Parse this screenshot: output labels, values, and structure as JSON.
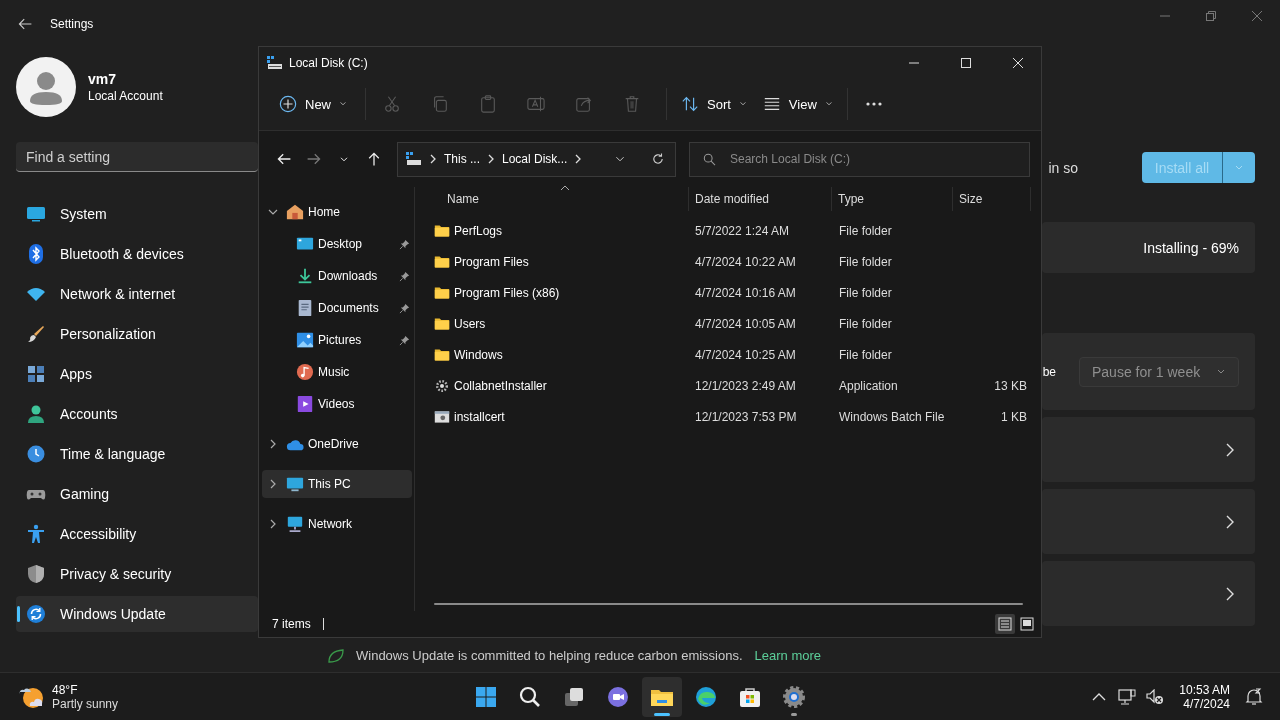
{
  "settings": {
    "title": "Settings",
    "user": {
      "name": "vm7",
      "account": "Local Account"
    },
    "search": {
      "placeholder": "Find a setting"
    },
    "nav": [
      {
        "label": "System",
        "selected": false
      },
      {
        "label": "Bluetooth & devices",
        "selected": false
      },
      {
        "label": "Network & internet",
        "selected": false
      },
      {
        "label": "Personalization",
        "selected": false
      },
      {
        "label": "Apps",
        "selected": false
      },
      {
        "label": "Accounts",
        "selected": false
      },
      {
        "label": "Time & language",
        "selected": false
      },
      {
        "label": "Gaming",
        "selected": false
      },
      {
        "label": "Accessibility",
        "selected": false
      },
      {
        "label": "Privacy & security",
        "selected": false
      },
      {
        "label": "Windows Update",
        "selected": true
      }
    ],
    "update": {
      "status_tail": "in so",
      "install_button": {
        "label": "Install all",
        "disabled": true
      },
      "progress": "Installing - 69%",
      "pause_tail": "be",
      "pause_dropdown": "Pause for 1 week",
      "footer": "Windows Update is committed to helping reduce carbon emissions.",
      "footer_link": "Learn more"
    }
  },
  "explorer": {
    "title": "Local Disk (C:)",
    "new_button": "New",
    "actions": [
      {
        "disabled": true
      },
      {
        "disabled": true
      },
      {
        "disabled": true
      },
      {
        "disabled": true
      },
      {
        "disabled": true
      },
      {
        "disabled": true
      }
    ],
    "sort_button": "Sort",
    "view_button": "View",
    "nav_buttons": [
      {
        "disabled": false
      },
      {
        "disabled": true
      },
      {
        "disabled": false
      },
      {
        "disabled": false
      }
    ],
    "breadcrumb": [
      "This ...",
      "Local Disk..."
    ],
    "search": {
      "placeholder": "Search Local Disk (C:)"
    },
    "tree": [
      {
        "label": "Home",
        "expanded": true,
        "selected": false,
        "children": [
          {
            "label": "Desktop",
            "pinned": true,
            "selected": false
          },
          {
            "label": "Downloads",
            "pinned": true,
            "selected": false
          },
          {
            "label": "Documents",
            "pinned": true,
            "selected": false
          },
          {
            "label": "Pictures",
            "pinned": true,
            "selected": false
          },
          {
            "label": "Music",
            "pinned": false,
            "selected": false
          },
          {
            "label": "Videos",
            "pinned": false,
            "selected": false
          }
        ]
      },
      {
        "label": "OneDrive",
        "expanded": false,
        "selected": false
      },
      {
        "label": "This PC",
        "expanded": false,
        "selected": true
      },
      {
        "label": "Network",
        "expanded": false,
        "selected": false
      }
    ],
    "columns": [
      "Name",
      "Date modified",
      "Type",
      "Size"
    ],
    "files": [
      {
        "kind": "folder",
        "name": "PerfLogs",
        "date": "5/7/2022 1:24 AM",
        "type": "File folder"
      },
      {
        "kind": "folder",
        "name": "Program Files",
        "date": "4/7/2024 10:22 AM",
        "type": "File folder"
      },
      {
        "kind": "folder",
        "name": "Program Files (x86)",
        "date": "4/7/2024 10:16 AM",
        "type": "File folder"
      },
      {
        "kind": "folder",
        "name": "Users",
        "date": "4/7/2024 10:05 AM",
        "type": "File folder"
      },
      {
        "kind": "folder",
        "name": "Windows",
        "date": "4/7/2024 10:25 AM",
        "type": "File folder"
      },
      {
        "kind": "application",
        "name": "CollabnetInstaller",
        "date": "12/1/2023 2:49 AM",
        "type": "Application",
        "size": "13 KB"
      },
      {
        "kind": "batch",
        "name": "installcert",
        "date": "12/1/2023 7:53 PM",
        "type": "Windows Batch File",
        "size": "1 KB"
      }
    ],
    "status": "7 items",
    "view_modes": [
      {
        "selected": true
      },
      {
        "selected": false
      }
    ]
  },
  "taskbar": {
    "weather": {
      "temp": "48°F",
      "condition": "Partly sunny"
    },
    "apps": [
      {
        "active": false,
        "running": false
      },
      {
        "active": false,
        "running": false
      },
      {
        "active": false,
        "running": false
      },
      {
        "active": false,
        "running": false
      },
      {
        "active": true,
        "running": true
      },
      {
        "active": false,
        "running": false
      },
      {
        "active": false,
        "running": false
      },
      {
        "active": false,
        "running": true
      }
    ],
    "time": "10:53 AM",
    "date": "4/7/2024"
  }
}
